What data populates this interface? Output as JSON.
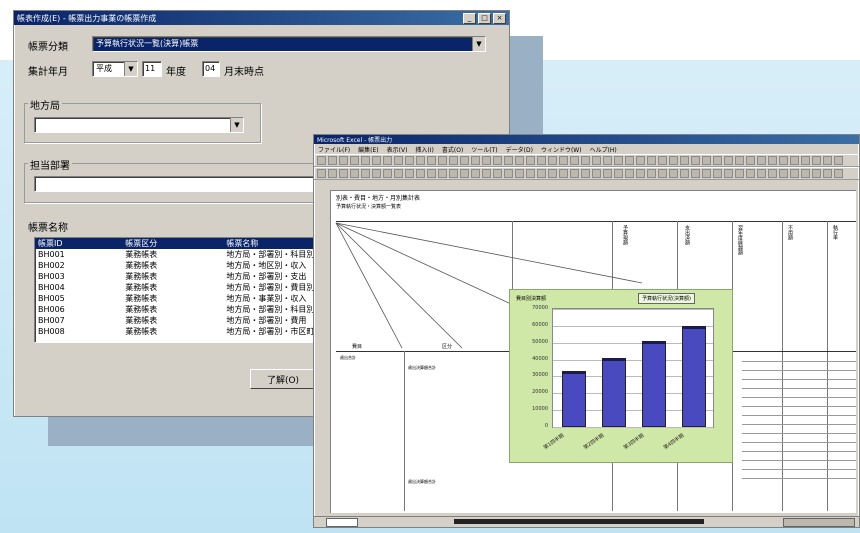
{
  "dialog": {
    "title": "帳表作成(E) - 帳票出力事業の帳票作成",
    "form_type_label": "帳票分類",
    "form_type_value": "予算執行状況一覧(決算)帳票",
    "period_label": "集計年月",
    "era_value": "平成",
    "year_value": "11",
    "year_unit": "年度",
    "month_value": "04",
    "month_unit": "月末時点",
    "region_label": "地方局",
    "region_value": "",
    "department_label": "担当部署",
    "department_value": "",
    "forms_label": "帳票名称",
    "list_headers": [
      "帳票ID",
      "帳票区分",
      "帳票名称"
    ],
    "list_rows": [
      [
        "BH001",
        "業務帳表",
        "地方局・部署別・科目別"
      ],
      [
        "BH002",
        "業務帳表",
        "地方局・地区別・収入"
      ],
      [
        "BH003",
        "業務帳表",
        "地方局・部署別・支出"
      ],
      [
        "BH004",
        "業務帳表",
        "地方局・部署別・費目別"
      ],
      [
        "BH005",
        "業務帳表",
        "地方局・事業別・収入"
      ],
      [
        "BH006",
        "業務帳表",
        "地方局・部署別・科目別"
      ],
      [
        "BH007",
        "業務帳表",
        "地方局・部署別・費用"
      ],
      [
        "BH008",
        "業務帳表",
        "地方局・部署別・市区町村"
      ]
    ],
    "ok_button": "了解(O)"
  },
  "excel": {
    "title": "Microsoft Excel - 帳票出力",
    "menu": [
      "ファイル(F)",
      "編集(E)",
      "表示(V)",
      "挿入(I)",
      "書式(O)",
      "ツール(T)",
      "データ(D)",
      "ウィンドウ(W)",
      "ヘルプ(H)"
    ],
    "sheet_title": "別表・費目・地方・月別集計表",
    "sheet_subtitle": "予算執行状況・決算額一覧表",
    "row_label_a": "費目",
    "row_label_b": "区分",
    "cell_label_1": "歳出合計",
    "cell_label_2": "歳出決算額合計",
    "cell_label_3": "歳出決算額合計",
    "column_headers": [
      "予算現額",
      "支出済額",
      "翌年度繰越額",
      "不用額",
      "執行率"
    ]
  },
  "chart_data": {
    "type": "bar",
    "title": "費目別決算額",
    "legend": "予算執行状況(決算額)",
    "categories": [
      "第1四半期",
      "第2四半期",
      "第3四半期",
      "第4四半期"
    ],
    "values": [
      33000,
      41000,
      51000,
      60000
    ],
    "ylim": [
      0,
      70000
    ],
    "yticks": [
      "70000",
      "60000",
      "50000",
      "40000",
      "30000",
      "20000",
      "10000",
      "0"
    ]
  },
  "colors": {
    "bar": "#4a4ac0",
    "chart_bg": "#cfe7a7",
    "titlebar": "#0a246a"
  }
}
